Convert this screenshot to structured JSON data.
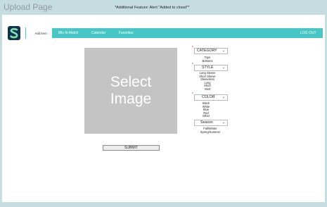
{
  "page": {
    "title": "Upload Page",
    "note": "*Additional Feature: Alert \"Added to closet\"*"
  },
  "nav": {
    "add_item": "Add Item",
    "items": [
      "Mix-N-Match",
      "Calendar",
      "Favorites"
    ],
    "logout": "LOG OUT",
    "accent_color": "#46c7c6"
  },
  "upload": {
    "image_placeholder": "Select Image",
    "submit_label": "SUBMIT"
  },
  "fields": {
    "category": {
      "label": "CATEGORY",
      "required_mark": "*",
      "options": [
        "Tops",
        "Bottoms"
      ]
    },
    "style": {
      "label": "STYLE",
      "required_mark": "*",
      "options": [
        "Long Sleeve",
        "Short Sleeve",
        "Sleeveless",
        "Long",
        "Short",
        "Skirt"
      ]
    },
    "color": {
      "label": "COLOR",
      "required_mark": "*",
      "options": [
        "Black",
        "White",
        "Blue",
        "Red",
        "Other"
      ]
    },
    "season": {
      "label": "Season",
      "options": [
        "Fall/Winter",
        "Spring/Summer"
      ]
    }
  }
}
